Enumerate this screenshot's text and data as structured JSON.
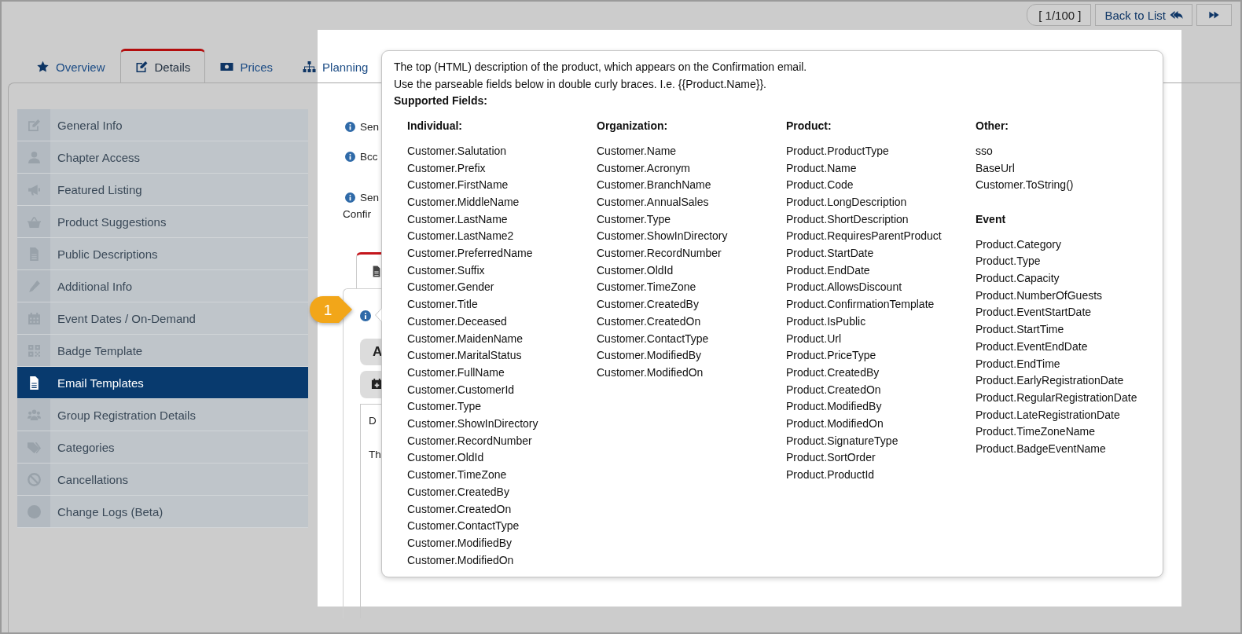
{
  "pager": {
    "position": "[ 1/100 ]",
    "back_label": "Back to List"
  },
  "tabs": [
    {
      "label": "Overview",
      "selected": false
    },
    {
      "label": "Details",
      "selected": true
    },
    {
      "label": "Prices",
      "selected": false
    },
    {
      "label": "Planning",
      "selected": false
    }
  ],
  "sidebar": {
    "items": [
      {
        "label": "General Info",
        "selected": false
      },
      {
        "label": "Chapter Access",
        "selected": false
      },
      {
        "label": "Featured Listing",
        "selected": false
      },
      {
        "label": "Product Suggestions",
        "selected": false
      },
      {
        "label": "Public Descriptions",
        "selected": false
      },
      {
        "label": "Additional Info",
        "selected": false
      },
      {
        "label": "Event Dates / On-Demand",
        "selected": false
      },
      {
        "label": "Badge Template",
        "selected": false
      },
      {
        "label": "Email Templates",
        "selected": true
      },
      {
        "label": "Group Registration Details",
        "selected": false
      },
      {
        "label": "Categories",
        "selected": false
      },
      {
        "label": "Cancellations",
        "selected": false
      },
      {
        "label": "Change Logs (Beta)",
        "selected": false
      }
    ]
  },
  "content": {
    "settings": [
      {
        "lines": [
          "Sen"
        ]
      },
      {
        "lines": [
          "Bcc"
        ]
      },
      {
        "lines": [
          "Sen",
          "Confir"
        ]
      }
    ],
    "buttons": [
      "A"
    ],
    "editor_lines": [
      "D",
      "Th"
    ]
  },
  "step_badge": "1",
  "popover": {
    "description_lines": [
      "The top (HTML) description of the product, which appears on the Confirmation email.",
      "Use the parseable fields below in double curly braces. I.e. {{Product.Name}}."
    ],
    "heading": "Supported Fields:",
    "columns": [
      {
        "groups": [
          {
            "title": "Individual:",
            "fields": [
              "Customer.Salutation",
              "Customer.Prefix",
              "Customer.FirstName",
              "Customer.MiddleName",
              "Customer.LastName",
              "Customer.LastName2",
              "Customer.PreferredName",
              "Customer.Suffix",
              "Customer.Gender",
              "Customer.Title",
              "Customer.Deceased",
              "Customer.MaidenName",
              "Customer.MaritalStatus",
              "Customer.FullName",
              "Customer.CustomerId",
              "Customer.Type",
              "Customer.ShowInDirectory",
              "Customer.RecordNumber",
              "Customer.OldId",
              "Customer.TimeZone",
              "Customer.CreatedBy",
              "Customer.CreatedOn",
              "Customer.ContactType",
              "Customer.ModifiedBy",
              "Customer.ModifiedOn"
            ]
          }
        ]
      },
      {
        "groups": [
          {
            "title": "Organization:",
            "fields": [
              "Customer.Name",
              "Customer.Acronym",
              "Customer.BranchName",
              "Customer.AnnualSales",
              "Customer.Type",
              "Customer.ShowInDirectory",
              "Customer.RecordNumber",
              "Customer.OldId",
              "Customer.TimeZone",
              "Customer.CreatedBy",
              "Customer.CreatedOn",
              "Customer.ContactType",
              "Customer.ModifiedBy",
              "Customer.ModifiedOn"
            ]
          }
        ]
      },
      {
        "groups": [
          {
            "title": "Product:",
            "fields": [
              "Product.ProductType",
              "Product.Name",
              "Product.Code",
              "Product.LongDescription",
              "Product.ShortDescription",
              "Product.RequiresParentProduct",
              "Product.StartDate",
              "Product.EndDate",
              "Product.AllowsDiscount",
              "Product.ConfirmationTemplate",
              "Product.IsPublic",
              "Product.Url",
              "Product.PriceType",
              "Product.CreatedBy",
              "Product.CreatedOn",
              "Product.ModifiedBy",
              "Product.ModifiedOn",
              "Product.SignatureType",
              "Product.SortOrder",
              "Product.ProductId"
            ]
          }
        ]
      },
      {
        "groups": [
          {
            "title": "Other:",
            "fields": [
              "sso",
              "BaseUrl",
              "Customer.ToString()"
            ]
          },
          {
            "title": "Event",
            "fields": [
              "Product.Category",
              "Product.Type",
              "Product.Capacity",
              "Product.NumberOfGuests",
              "Product.EventStartDate",
              "Product.StartTime",
              "Product.EventEndDate",
              "Product.EndTime",
              "Product.EarlyRegistrationDate",
              "Product.RegularRegistrationDate",
              "Product.LateRegistrationDate",
              "Product.TimeZoneName",
              "Product.BadgeEventName"
            ]
          }
        ]
      }
    ]
  }
}
